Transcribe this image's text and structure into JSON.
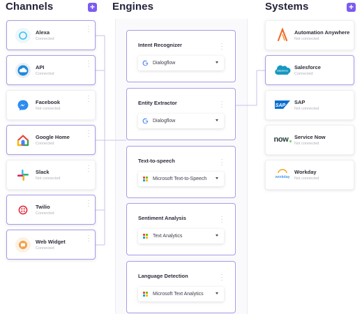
{
  "headings": {
    "channels": "Channels",
    "engines": "Engines",
    "systems": "Systems",
    "add_label": "+"
  },
  "colors": {
    "accent": "#7b5cf0",
    "connected_border": "#a99be6",
    "status_text": "#b0b0bc"
  },
  "channels": [
    {
      "name": "Alexa",
      "status": "Connected",
      "icon": "alexa-icon",
      "connected": true
    },
    {
      "name": "API",
      "status": "Connected",
      "icon": "api-cloud-icon",
      "connected": true
    },
    {
      "name": "Facebook",
      "status": "Not connected",
      "icon": "messenger-icon",
      "connected": false
    },
    {
      "name": "Google Home",
      "status": "Connected",
      "icon": "google-home-icon",
      "connected": true
    },
    {
      "name": "Slack",
      "status": "Not connected",
      "icon": "slack-icon",
      "connected": false
    },
    {
      "name": "Twilio",
      "status": "Connected",
      "icon": "twilio-icon",
      "connected": true
    },
    {
      "name": "Web Widget",
      "status": "Connected",
      "icon": "web-widget-icon",
      "connected": true
    }
  ],
  "engines": [
    {
      "title": "Intent Recognizer",
      "provider": "Dialogflow",
      "provider_icon": "google-g-icon"
    },
    {
      "title": "Entity Extractor",
      "provider": "Dialogflow",
      "provider_icon": "google-g-icon"
    },
    {
      "title": "Text-to-speech",
      "provider": "Microsoft Text-to-Speech",
      "provider_icon": "microsoft-icon"
    },
    {
      "title": "Sentiment Analysis",
      "provider": "Text Analytics",
      "provider_icon": "microsoft-icon"
    },
    {
      "title": "Language Detection",
      "provider": "Microsoft Text Analytics",
      "provider_icon": "microsoft-icon"
    }
  ],
  "systems": [
    {
      "name": "Automation Anywhere",
      "status": "Not connected",
      "logo": "automation-anywhere-logo",
      "connected": false
    },
    {
      "name": "Salesforce",
      "status": "Connected",
      "logo": "salesforce-logo",
      "connected": true,
      "logo_text": "salesforce"
    },
    {
      "name": "SAP",
      "status": "Not connected",
      "logo": "sap-logo",
      "connected": false,
      "logo_text": "SAP"
    },
    {
      "name": "Service Now",
      "status": "Not connected",
      "logo": "servicenow-logo",
      "connected": false,
      "logo_text": "now"
    },
    {
      "name": "Workday",
      "status": "Not connected",
      "logo": "workday-logo",
      "connected": false,
      "logo_text": "workday"
    }
  ]
}
